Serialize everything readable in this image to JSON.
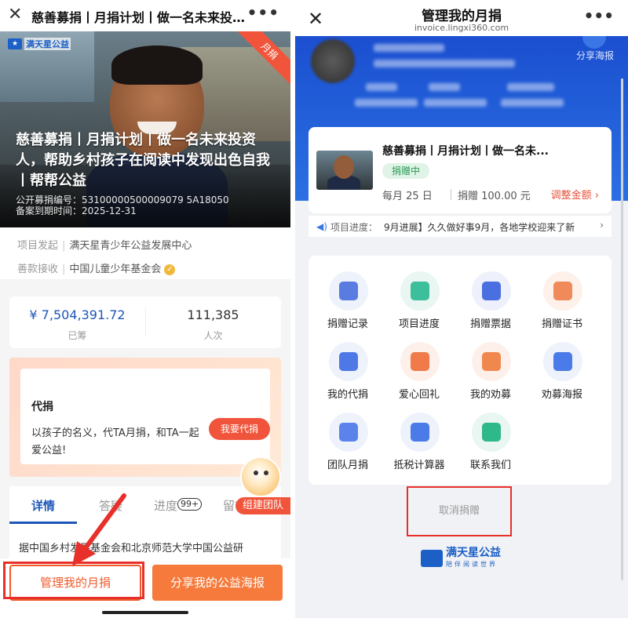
{
  "left": {
    "topbar": {
      "close": "✕",
      "title": "慈善募捐丨月捐计划丨做一名未来投…",
      "more": "•••"
    },
    "hero": {
      "logo_text": "满天星公益",
      "ribbon": "月捐",
      "title": "慈善募捐丨月捐计划丨做一名未来投资人，帮助乡村孩子在阅读中发现出色自我丨帮帮公益",
      "registration": "公开募捐编号：53100000500009079 5A18050",
      "period": "备案到期时间：2025-12-31"
    },
    "org": {
      "initiator_key": "项目发起",
      "initiator_val": "满天星青少年公益发展中心",
      "receiver_key": "善款接收",
      "receiver_val": "中国儿童少年基金会"
    },
    "stats": {
      "raised": "¥ 7,504,391.72",
      "raised_label": "已筹",
      "donors": "111,385",
      "donors_label": "人次"
    },
    "proxy": {
      "heading": "代捐",
      "desc": "以孩子的名义，代TA月捐，和TA一起爱公益!",
      "button": "我要代捐"
    },
    "team_button": "组建团队",
    "tabs": [
      {
        "label": "详情"
      },
      {
        "label": "答疑"
      },
      {
        "label": "进度"
      },
      {
        "label": "留言"
      }
    ],
    "progress_badge": "99+",
    "description": "据中国乡村发展基金会和北京师范大学中国公益研",
    "bottom": {
      "manage": "管理我的月捐",
      "share": "分享我的公益海报"
    }
  },
  "right": {
    "topbar": {
      "close": "✕",
      "title": "管理我的月捐",
      "url": "invoice.lingxi360.com",
      "more": "•••"
    },
    "share_poster": "分享海报",
    "plan": {
      "title": "慈善募捐丨月捐计划丨做一名未...",
      "status": "捐赠中",
      "day": "每月 25 日",
      "amount": "捐赠 100.00 元",
      "adjust": "调整金额"
    },
    "progress": {
      "label": "项目进度：",
      "text": "9月进展】久久做好事9月，各地学校迎来了新"
    },
    "menu": [
      {
        "label": "捐赠记录",
        "icon": "donation-record-icon",
        "bg": "#eef2fb",
        "fg": "#5a7be0"
      },
      {
        "label": "项目进度",
        "icon": "project-progress-icon",
        "bg": "#e9f6f1",
        "fg": "#3cbf9a"
      },
      {
        "label": "捐赠票据",
        "icon": "donation-receipt-icon",
        "bg": "#eef1fb",
        "fg": "#4a6fe0"
      },
      {
        "label": "捐赠证书",
        "icon": "donation-certificate-icon",
        "bg": "#fdf1ea",
        "fg": "#f08a5a"
      },
      {
        "label": "我的代捐",
        "icon": "my-proxy-donation-icon",
        "bg": "#eef2fb",
        "fg": "#4d78e6"
      },
      {
        "label": "爱心回礼",
        "icon": "gift-icon",
        "bg": "#fdf0ea",
        "fg": "#f07a4a"
      },
      {
        "label": "我的劝募",
        "icon": "my-fundraising-icon",
        "bg": "#fdf0ea",
        "fg": "#f0884e"
      },
      {
        "label": "劝募海报",
        "icon": "fundraising-poster-icon",
        "bg": "#eef2fb",
        "fg": "#4a7be8"
      },
      {
        "label": "团队月捐",
        "icon": "team-donation-icon",
        "bg": "#eef2fb",
        "fg": "#5a84ea"
      },
      {
        "label": "抵税计算器",
        "icon": "tax-calculator-icon",
        "bg": "#eef2fb",
        "fg": "#4a7be8"
      },
      {
        "label": "联系我们",
        "icon": "contact-us-icon",
        "bg": "#e9f6f1",
        "fg": "#2fb88a"
      }
    ],
    "cancel": "取消捐赠",
    "brand": {
      "name": "满天星公益",
      "slogan": "陪伴阅读世界"
    }
  }
}
